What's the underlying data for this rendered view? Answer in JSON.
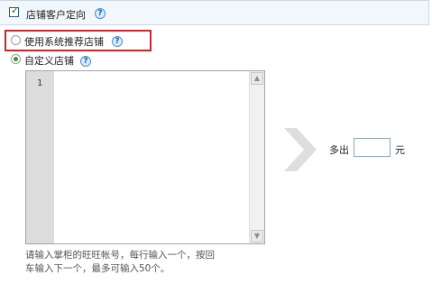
{
  "header": {
    "checkbox_label": "店铺客户定向",
    "checked": true
  },
  "options": [
    {
      "label": "使用系统推荐店铺",
      "selected": false
    },
    {
      "label": "自定义店铺",
      "selected": true
    }
  ],
  "editor": {
    "line_number": "1",
    "value": ""
  },
  "amount": {
    "prefix": "多出",
    "suffix": "元",
    "value": ""
  },
  "hint": {
    "line1": "请输入掌柜的旺旺帐号，每行输入一个，按回",
    "line2": "车输入下一个，最多可输入50个。"
  },
  "icons": {
    "help": "?",
    "scroll_up": "▲",
    "scroll_down": "▼",
    "check": "✓"
  }
}
